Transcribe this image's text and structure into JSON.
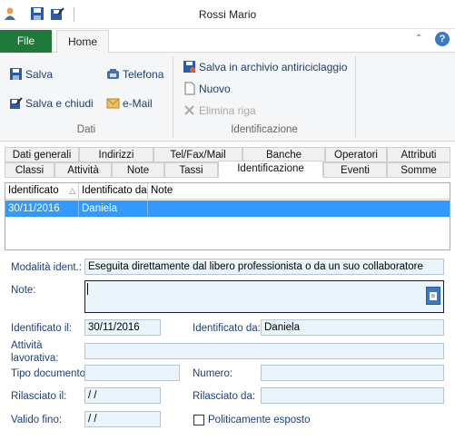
{
  "window": {
    "title": "Rossi Mario"
  },
  "ribbon": {
    "tabs": {
      "file": "File",
      "home": "Home"
    },
    "dati": {
      "salva": "Salva",
      "salva_chiudi": "Salva e chiudi",
      "telefona": "Telefona",
      "email": "e-Mail",
      "group": "Dati"
    },
    "ident": {
      "salva_archivio": "Salva in archivio antiriciclaggio",
      "nuovo": "Nuovo",
      "elimina": "Elimina riga",
      "group": "Identificazione"
    }
  },
  "tabs": {
    "row1": [
      "Dati generali",
      "Indirizzi",
      "Tel/Fax/Mail",
      "Banche",
      "Operatori",
      "Attributi"
    ],
    "row2": [
      "Classi",
      "Attività",
      "Note",
      "Tassi",
      "Identificazione",
      "Eventi",
      "Somme"
    ]
  },
  "grid": {
    "headers": [
      "Identificato",
      "Identificato da",
      "Note"
    ],
    "sort_glyph": "△",
    "row": [
      "30/11/2016",
      "Daniela",
      ""
    ]
  },
  "form": {
    "modalita_label": "Modalità ident.:",
    "modalita_value": "Eseguita direttamente dal libero professionista o da un suo collaboratore",
    "note_label": "Note:",
    "note_value": "",
    "identificato_il_label": "Identificato il:",
    "identificato_il_value": "30/11/2016",
    "identificato_da_label": "Identificato da:",
    "identificato_da_value": "Daniela",
    "attivita_label_1": "Attività",
    "attivita_label_2": "lavorativa:",
    "attivita_value": "",
    "tipo_doc_label": "Tipo documento:",
    "tipo_doc_value": "",
    "numero_label": "Numero:",
    "numero_value": "",
    "rilasciato_il_label": "Rilasciato il:",
    "rilasciato_il_value": " /  /",
    "rilasciato_da_label": "Rilasciato da:",
    "rilasciato_da_value": "",
    "valido_label": "Valido fino:",
    "valido_value": " /  /",
    "pol_label": "Politicamente esposto"
  },
  "colors": {
    "file_tab": "#1f7a3a",
    "selection": "#3399ff",
    "label": "#1d3f7a"
  }
}
